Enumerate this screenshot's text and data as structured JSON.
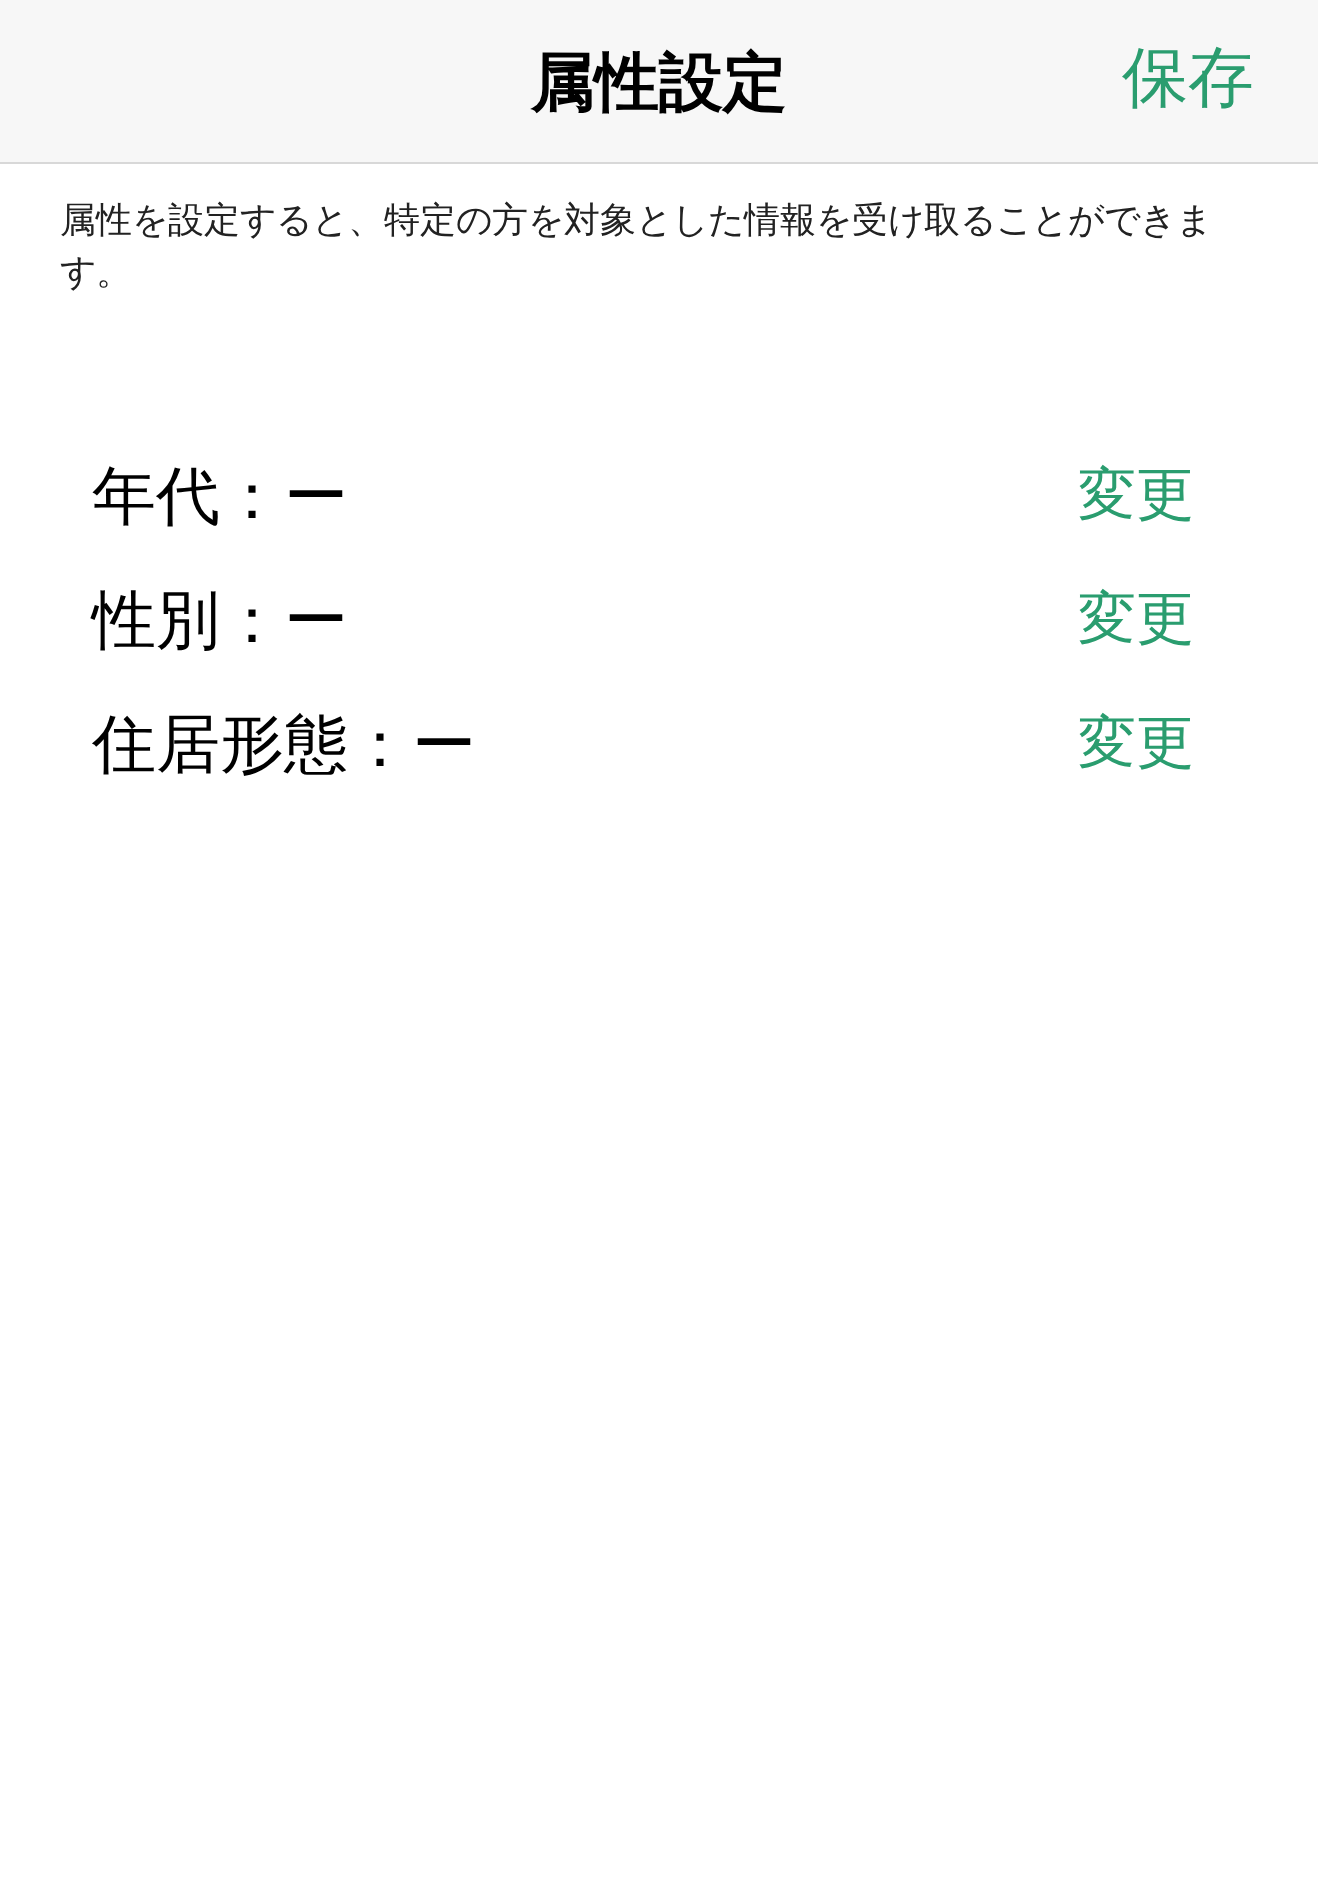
{
  "header": {
    "title": "属性設定",
    "save_button": "保存"
  },
  "description": "属性を設定すると、特定の方を対象とした情報を受け取ることができます。",
  "attributes": [
    {
      "text": "年代：ー",
      "action": "変更"
    },
    {
      "text": "性別：ー",
      "action": "変更"
    },
    {
      "text": "住居形態：ー",
      "action": "変更"
    }
  ]
}
